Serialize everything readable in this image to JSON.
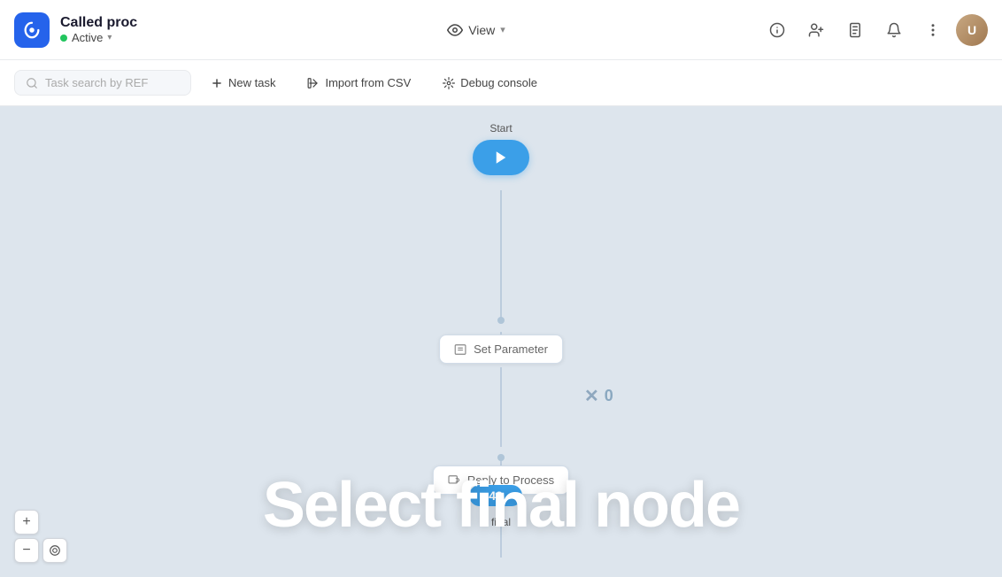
{
  "header": {
    "app_title": "Called proc",
    "status_label": "Active",
    "view_label": "View",
    "icons": {
      "info": "ℹ",
      "add_user": "👤",
      "document": "📄",
      "bell": "🔔",
      "more": "⋯"
    }
  },
  "toolbar": {
    "search_placeholder": "Task search by REF",
    "new_task_label": "New task",
    "import_label": "Import from CSV",
    "debug_label": "Debug console"
  },
  "canvas": {
    "start_label": "Start",
    "set_parameter_label": "Set Parameter",
    "reply_label": "Reply to Process",
    "x_count": "0",
    "badge_count": "42",
    "overlay_text": "Select final node",
    "final_label": "final"
  },
  "zoom": {
    "plus": "+",
    "minus": "−",
    "fit": "⊙"
  }
}
